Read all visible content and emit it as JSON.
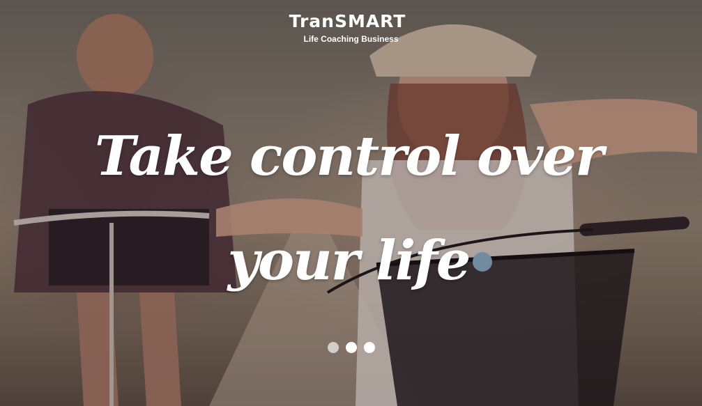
{
  "brand": {
    "title": "TranSMART",
    "subtitle": "Life Coaching Business"
  },
  "hero": {
    "headline": "Take control over your life"
  },
  "slider": {
    "dots": [
      {
        "state": "inactive"
      },
      {
        "state": "active"
      },
      {
        "state": "active"
      }
    ]
  },
  "colors": {
    "text": "#ffffff",
    "overlay": "#28191e"
  }
}
